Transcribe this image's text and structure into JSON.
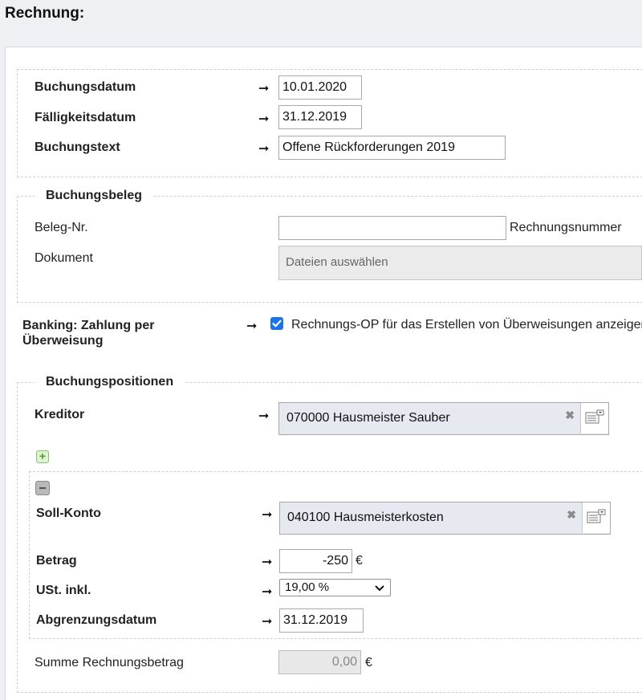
{
  "page_title": "Rechnung:",
  "header": {
    "buchungsdatum_label": "Buchungsdatum",
    "buchungsdatum_value": "10.01.2020",
    "faelligkeitsdatum_label": "Fälligkeitsdatum",
    "faelligkeitsdatum_value": "31.12.2019",
    "buchungstext_label": "Buchungstext",
    "buchungstext_value": "Offene Rückforderungen 2019",
    "arrow": "➞"
  },
  "beleg": {
    "legend": "Buchungsbeleg",
    "belegnr_label": "Beleg-Nr.",
    "belegnr_value": "",
    "belegnr_hint": "Rechnungsnummer",
    "dokument_label": "Dokument",
    "dokument_button": "Dateien auswählen"
  },
  "banking": {
    "label": "Banking: Zahlung per Überweisung",
    "checkbox_label": "Rechnungs-OP für das Erstellen von Überweisungen anzeigen",
    "checked": true
  },
  "positionen": {
    "legend": "Buchungspositionen",
    "kreditor_label": "Kreditor",
    "kreditor_value": "070000 Hausmeister Sauber",
    "soll_label": "Soll-Konto",
    "soll_value": "040100 Hausmeisterkosten",
    "betrag_label": "Betrag",
    "betrag_value": "-250",
    "currency": "€",
    "ust_label": "USt. inkl.",
    "ust_value": "19,00 %",
    "abgrenzung_label": "Abgrenzungsdatum",
    "abgrenzung_value": "31.12.2019",
    "summe_label": "Summe Rechnungsbetrag",
    "summe_value": "0,00"
  },
  "icons": {
    "clear": "✖",
    "plus": "+"
  }
}
